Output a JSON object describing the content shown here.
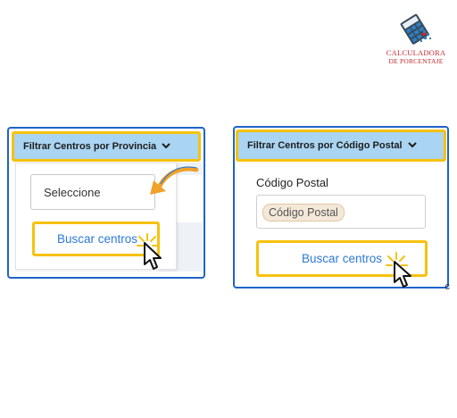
{
  "logo": {
    "line1": "CALCULADORA",
    "line2": "DE PORCENTAJE",
    "brand_color": "#c4282c",
    "icon": "calculator-grid-icon"
  },
  "left_panel": {
    "filter_button_label": "Filtrar Centros por Provincia",
    "select_value": "Seleccione",
    "search_button_label": "Buscar centros"
  },
  "right_panel": {
    "filter_button_label": "Filtrar Centros por Código Postal",
    "postal_label": "Código Postal",
    "postal_placeholder": "Código Postal",
    "search_button_label": "Buscar centros",
    "cut_text": "c"
  },
  "colors": {
    "panel_border": "#1f63c9",
    "highlight": "#f6c20e",
    "filter_bg": "#a9d4f2",
    "link_text": "#2c79d6",
    "arrow": "#f0a22a"
  },
  "icons": [
    "chevron-down-icon",
    "pointer-cursor-icon",
    "click-rays-icon",
    "curved-arrow-icon"
  ]
}
